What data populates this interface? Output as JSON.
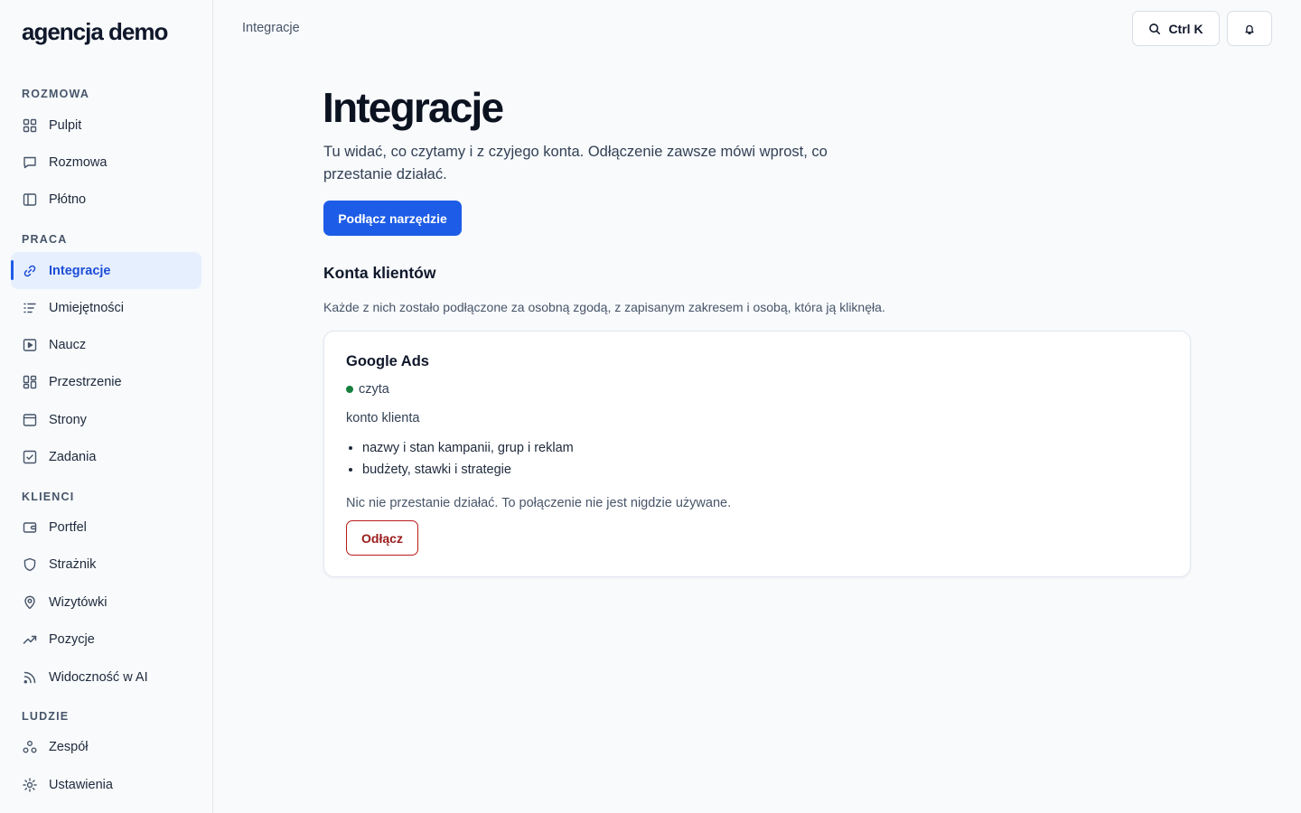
{
  "brand": {
    "name": "agencja demo"
  },
  "sidebar": {
    "sections": [
      {
        "label": "ROZMOWA"
      },
      {
        "label": "PRACA"
      },
      {
        "label": "KLIENCI"
      },
      {
        "label": "LUDZIE"
      }
    ],
    "items": [
      {
        "label": "Pulpit",
        "icon": "grid-icon"
      },
      {
        "label": "Rozmowa",
        "icon": "chat-icon"
      },
      {
        "label": "Płótno",
        "icon": "panel-icon"
      },
      {
        "label": "Integracje",
        "icon": "link-icon",
        "active": true
      },
      {
        "label": "Umiejętności",
        "icon": "list-icon"
      },
      {
        "label": "Naucz",
        "icon": "play-icon"
      },
      {
        "label": "Przestrzenie",
        "icon": "layout-icon"
      },
      {
        "label": "Strony",
        "icon": "browser-icon"
      },
      {
        "label": "Zadania",
        "icon": "checkbox-icon"
      },
      {
        "label": "Portfel",
        "icon": "wallet-icon"
      },
      {
        "label": "Strażnik",
        "icon": "shield-icon"
      },
      {
        "label": "Wizytówki",
        "icon": "map-pin-icon"
      },
      {
        "label": "Pozycje",
        "icon": "trending-up-icon"
      },
      {
        "label": "Widoczność w AI",
        "icon": "rss-icon"
      },
      {
        "label": "Zespół",
        "icon": "team-icon"
      },
      {
        "label": "Ustawienia",
        "icon": "settings-icon"
      }
    ]
  },
  "header": {
    "breadcrumb": "Integracje",
    "search_shortcut": "Ctrl K",
    "search_icon": "search-icon",
    "bell_icon": "bell-icon"
  },
  "main": {
    "title": "Integracje",
    "description": "Tu widać, co czytamy i z czyjego konta. Odłączenie zawsze mówi wprost, co przestanie działać.",
    "connect_button": "Podłącz narzędzie",
    "section_title": "Konta klientów",
    "section_description": "Każde z nich zostało podłączone za osobną zgodą, z zapisanym zakresem i osobą, która ją kliknęła."
  },
  "integration_card": {
    "name": "Google Ads",
    "status": "czyta",
    "status_color": "#15803d",
    "account_type": "konto klienta",
    "scopes": [
      "nazwy i stan kampanii, grup i reklam",
      "budżety, stawki i strategie"
    ],
    "impact": "Nic nie przestanie działać. To połączenie nie jest nigdzie używane.",
    "disconnect_button": "Odłącz"
  },
  "colors": {
    "accent": "#1d5ce6",
    "active_bg": "#e6effd",
    "danger": "#b91c1c"
  }
}
